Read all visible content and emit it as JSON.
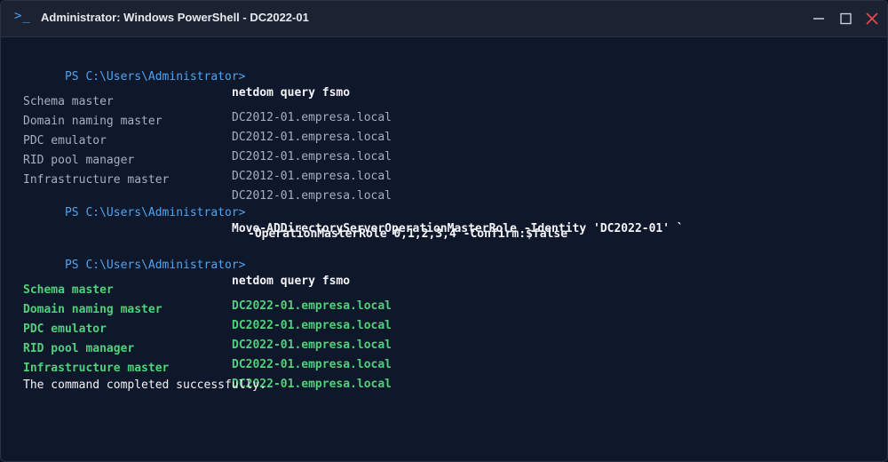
{
  "window": {
    "icon": "powershell-icon",
    "title": "Administrator: Windows PowerShell - DC2022-01"
  },
  "controls": {
    "minimize": "minimize-icon",
    "maximize": "maximize-icon",
    "close": "close-icon",
    "close_color": "#e5484d"
  },
  "terminal": {
    "prompt": "PS C:\\Users\\Administrator>",
    "command1": "netdom query fsmo",
    "before": [
      {
        "role": "Schema master",
        "holder": "DC2012-01.empresa.local"
      },
      {
        "role": "Domain naming master",
        "holder": "DC2012-01.empresa.local"
      },
      {
        "role": "PDC emulator",
        "holder": "DC2012-01.empresa.local"
      },
      {
        "role": "RID pool manager",
        "holder": "DC2012-01.empresa.local"
      },
      {
        "role": "Infrastructure master",
        "holder": "DC2012-01.empresa.local"
      }
    ],
    "command2_line1": "Move-ADDirectoryServerOperationMasterRole -Identity 'DC2022-01' `",
    "command2_line2": "-OperationMasterRole 0,1,2,3,4 -Confirm:$false",
    "command3": "netdom query fsmo",
    "after": [
      {
        "role": "Schema master",
        "holder": "DC2022-01.empresa.local"
      },
      {
        "role": "Domain naming master",
        "holder": "DC2022-01.empresa.local"
      },
      {
        "role": "PDC emulator",
        "holder": "DC2022-01.empresa.local"
      },
      {
        "role": "RID pool manager",
        "holder": "DC2022-01.empresa.local"
      },
      {
        "role": "Infrastructure master",
        "holder": "DC2022-01.empresa.local"
      }
    ],
    "result": "The command completed successfully.",
    "colors": {
      "prompt": "#4ea4f0",
      "new_holder": "#4ed17a",
      "old_holder": "#a7b0bd",
      "background": "#0f172a"
    }
  }
}
